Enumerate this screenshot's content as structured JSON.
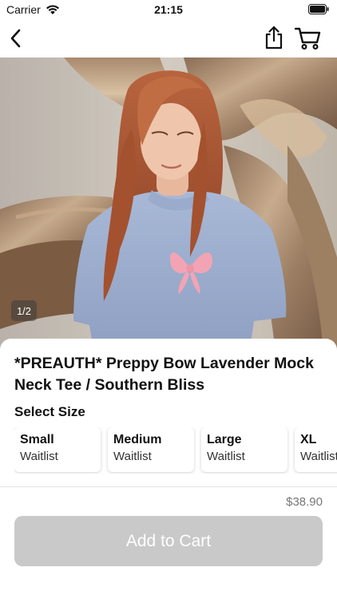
{
  "status_bar": {
    "carrier": "Carrier",
    "time": "21:15"
  },
  "nav": {
    "back_icon": "chevron-left-icon",
    "share_icon": "share-icon",
    "cart_icon": "cart-icon"
  },
  "gallery": {
    "counter": "1/2"
  },
  "product": {
    "title": "*PREAUTH* Preppy Bow Lavender Mock Neck Tee / Southern Bliss",
    "select_size_label": "Select Size",
    "sizes": [
      {
        "name": "Small",
        "status": "Waitlist"
      },
      {
        "name": "Medium",
        "status": "Waitlist"
      },
      {
        "name": "Large",
        "status": "Waitlist"
      },
      {
        "name": "XL",
        "status": "Waitlist"
      }
    ],
    "price": "$38.90",
    "add_to_cart_label": "Add to Cart"
  },
  "colors": {
    "button_disabled": "#c9c9c9",
    "price_text": "#777777"
  }
}
